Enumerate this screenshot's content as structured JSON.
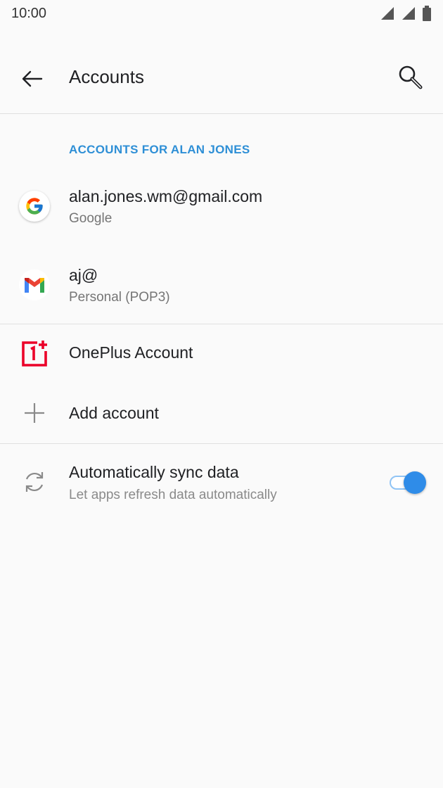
{
  "status_bar": {
    "time": "10:00",
    "icons": [
      "signal-icon",
      "signal-icon",
      "battery-icon"
    ]
  },
  "app_bar": {
    "title": "Accounts",
    "back_icon": "arrow-back-icon",
    "search_icon": "search-icon"
  },
  "section": {
    "header": "ACCOUNTS FOR ALAN JONES",
    "accent_color": "#2e8fd6"
  },
  "accounts": [
    {
      "title": "alan.jones.wm@gmail.com",
      "subtitle": "Google",
      "icon": "google-icon"
    },
    {
      "title": "aj@",
      "subtitle": "Personal (POP3)",
      "icon": "gmail-icon"
    }
  ],
  "oneplus": {
    "title": "OnePlus Account",
    "icon": "oneplus-icon",
    "color": "#eb0029"
  },
  "add_account": {
    "title": "Add account",
    "icon": "plus-icon"
  },
  "sync": {
    "title": "Automatically sync data",
    "subtitle": "Let apps refresh data automatically",
    "icon": "sync-icon",
    "enabled": true
  }
}
